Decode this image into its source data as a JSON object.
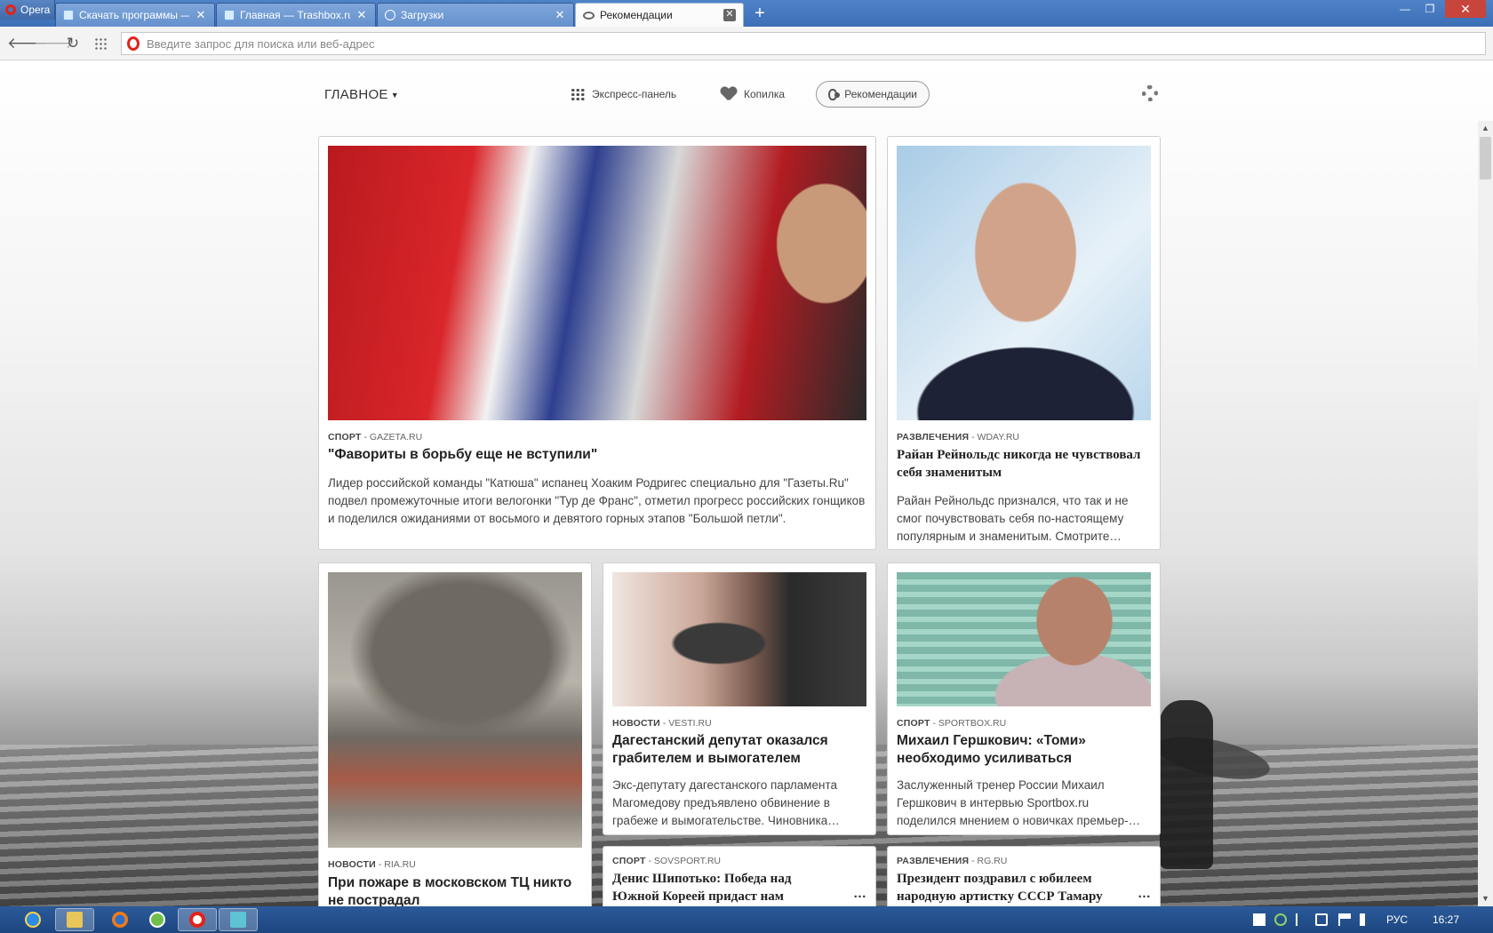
{
  "browser": {
    "menu_label": "Opera",
    "tabs": [
      {
        "title": "Скачать программы — Trashbox.ru",
        "icon": "trashbox-icon",
        "active": false
      },
      {
        "title": "Главная — Trashbox.ru",
        "icon": "trashbox-icon",
        "active": false
      },
      {
        "title": "Загрузки",
        "icon": "download-icon",
        "active": false
      },
      {
        "title": "Рекомендации",
        "icon": "eye-icon",
        "active": true
      }
    ],
    "new_tab_label": "+",
    "address_placeholder": "Введите запрос для поиска или веб-адрес"
  },
  "speed_dial": {
    "main_label": "ГЛАВНОЕ",
    "links": [
      {
        "label": "Экспресс-панель",
        "icon": "grid-icon",
        "active": false
      },
      {
        "label": "Копилка",
        "icon": "heart-icon",
        "active": false
      },
      {
        "label": "Рекомендации",
        "icon": "eye-icon",
        "active": true
      }
    ]
  },
  "cards": [
    {
      "category": "СПОРТ",
      "source": "- GAZETA.RU",
      "title": "\"Фавориты в борьбу еще не вступили\"",
      "description": "Лидер российской команды \"Катюша\" испанец Хоаким Родригес специально для \"Газеты.Ru\" подвел промежуточные итоги велогонки \"Тур де Франс\", отметил прогресс российских гонщиков и поделился ожиданиями от восьмого и девятого горных этапов \"Большой петли\"."
    },
    {
      "category": "РАЗВЛЕЧЕНИЯ",
      "source": "- WDAY.RU",
      "title": "Райан Рейнольдс никогда не чувствовал себя знаменитым",
      "description": "Райан Рейнольдс признался, что так и не смог почувствовать себя по-настоящему популярным и знаменитым. Смотрите…"
    },
    {
      "category": "НОВОСТИ",
      "source": "- RIA.RU",
      "title": "При пожаре в московском ТЦ никто не пострадал",
      "description": ""
    },
    {
      "category": "НОВОСТИ",
      "source": "- VESTI.RU",
      "title": "Дагестанский депутат оказался грабителем и вымогателем",
      "description": "Экс-депутату дагестанского парламента Магомедову предъявлено обвинение в грабеже и вымогательстве. Чиновника…"
    },
    {
      "category": "СПОРТ",
      "source": "- SPORTBOX.RU",
      "title": "Михаил Гершкович: «Томи» необходимо усиливаться",
      "description": "Заслуженный тренер России Михаил Гершкович в интервью Sportbox.ru поделился мнением о новичках премьер-…"
    },
    {
      "category": "СПОРТ",
      "source": "- SOVSPORT.RU",
      "title": "Денис Шипотько: Победа над Южной Кореей придаст нам",
      "description": ""
    },
    {
      "category": "РАЗВЛЕЧЕНИЯ",
      "source": "- RG.RU",
      "title": "Президент поздравил с юбилеем народную артистку СССР Тамару",
      "description": ""
    }
  ],
  "more_label": "…",
  "taskbar": {
    "apps": [
      "ie-icon",
      "explorer-icon",
      "firefox-icon",
      "utorrent-icon",
      "opera-icon",
      "screen-icon"
    ],
    "language": "РУС",
    "time": "16:27"
  }
}
